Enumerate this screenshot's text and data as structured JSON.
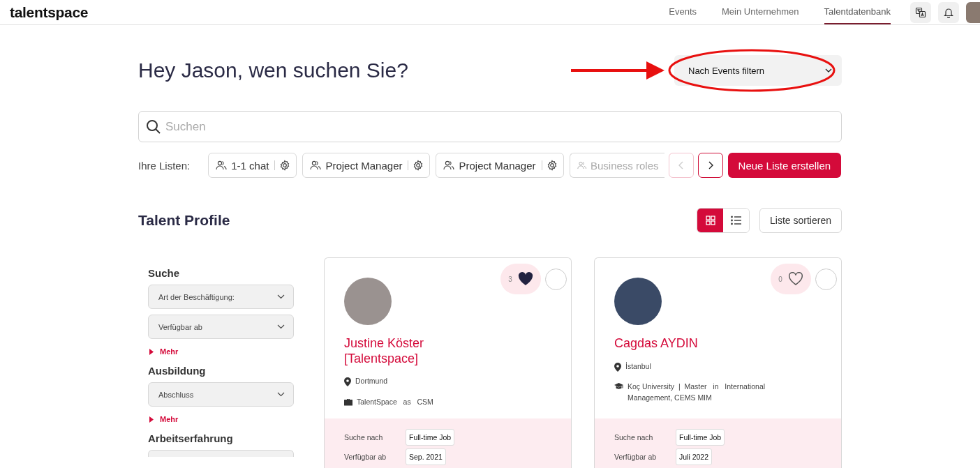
{
  "header": {
    "logo": "talentspace",
    "nav": [
      {
        "label": "Events",
        "selected": false
      },
      {
        "label": "Mein Unternehmen",
        "selected": false
      },
      {
        "label": "Talentdatenbank",
        "selected": true
      }
    ]
  },
  "greeting": "Hey Jason, wen suchen Sie?",
  "event_filter": {
    "value": "Nach Events filtern"
  },
  "search": {
    "placeholder": "Suchen"
  },
  "lists": {
    "label": "Ihre Listen:",
    "items": [
      {
        "name": "1-1 chat",
        "faded": false
      },
      {
        "name": "Project Manager",
        "faded": false
      },
      {
        "name": "Project Manager",
        "faded": false
      },
      {
        "name": "Business roles",
        "faded": true
      }
    ],
    "prev_disabled": true,
    "next_disabled": false,
    "create_button": "Neue Liste erstellen"
  },
  "section_title": "Talent Profile",
  "view_toggle": [
    {
      "kind": "grid",
      "selected": true
    },
    {
      "kind": "list",
      "selected": false
    }
  ],
  "sort_button": "Liste sortieren",
  "filters": [
    {
      "title": "Suche",
      "dropdowns": [
        "Art der Beschäftigung:",
        "Verfügbar ab"
      ],
      "more": "Mehr"
    },
    {
      "title": "Ausbildung",
      "dropdowns": [
        "Abschluss"
      ],
      "more": "Mehr"
    },
    {
      "title": "Arbeitserfahrung"
    }
  ],
  "profiles": [
    {
      "name": "Justine Köster [Talentspace]",
      "likes": "3",
      "liked": true,
      "details": [
        {
          "kind": "location",
          "text": "Dortmund"
        },
        {
          "kind": "job",
          "text": "TalentSpace   as   CSM"
        }
      ],
      "facts": [
        {
          "label": "Suche nach",
          "value": "Full-time Job"
        },
        {
          "label": "Verfügbar ab",
          "value": "Sep. 2021"
        }
      ]
    },
    {
      "name": "Cagdas AYDIN",
      "likes": "0",
      "liked": false,
      "details": [
        {
          "kind": "location",
          "text": "İstanbul"
        },
        {
          "kind": "education",
          "text": "Koç University  |  Master   in   International Management, CEMS MIM"
        }
      ],
      "facts": [
        {
          "label": "Suche nach",
          "value": "Full-time Job"
        },
        {
          "label": "Verfügbar ab",
          "value": "Juli 2022"
        }
      ]
    }
  ]
}
